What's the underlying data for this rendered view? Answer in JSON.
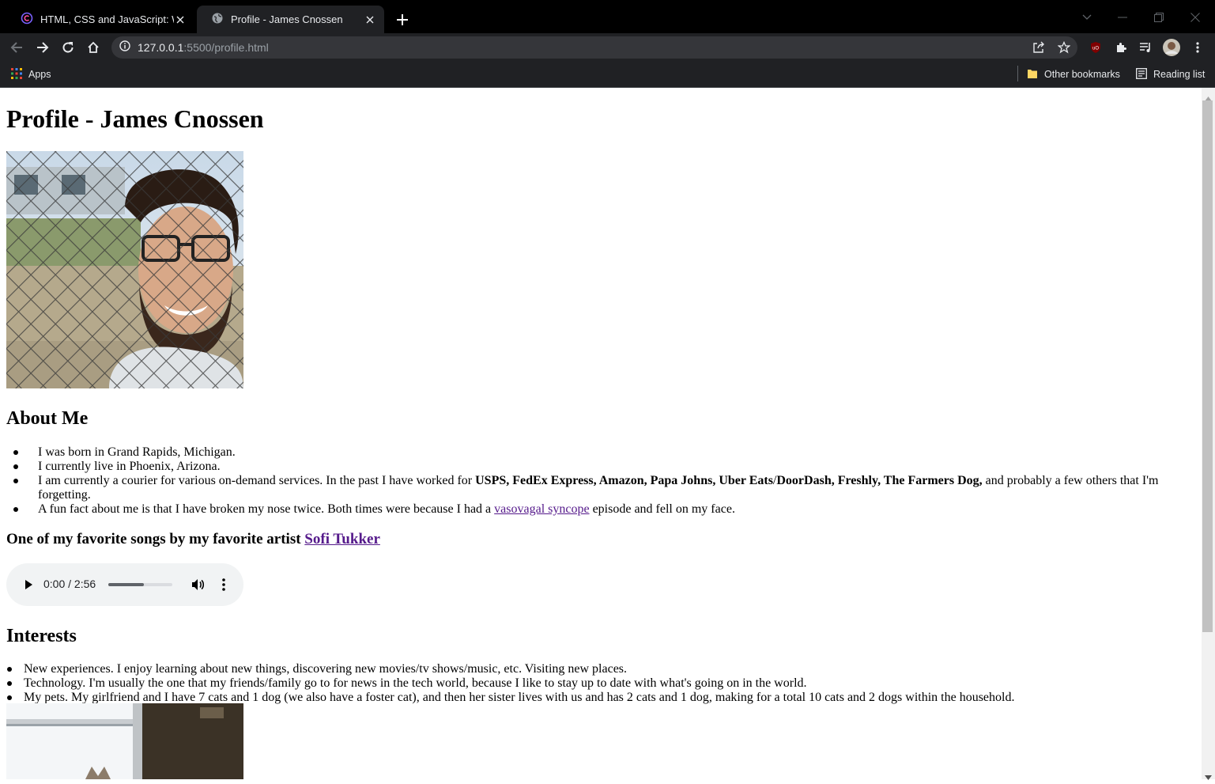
{
  "browser": {
    "tabs": [
      {
        "title": "HTML, CSS and JavaScript: Week",
        "active": false,
        "icon": "coursera-icon"
      },
      {
        "title": "Profile - James Cnossen",
        "active": true,
        "icon": "globe-icon"
      }
    ],
    "url": {
      "host": "127.0.0.1",
      "rest": ":5500/profile.html"
    },
    "bookmarks": {
      "apps_label": "Apps",
      "other_bookmarks_label": "Other bookmarks",
      "reading_list_label": "Reading list"
    },
    "extensions": [
      "ublock-icon",
      "puzzle-icon",
      "media-queue-icon",
      "profile-avatar"
    ]
  },
  "page": {
    "title": "Profile - James Cnossen",
    "about_heading": "About Me",
    "about_items": {
      "born": "I was born in Grand Rapids, Michigan.",
      "live": "I currently live in Phoenix, Arizona.",
      "work_prefix": "I am currently a courier for various on-demand services. In the past I have worked for ",
      "work_companies": "USPS, FedEx Express, Amazon, Papa Johns, Uber Eats",
      "work_sep": "/",
      "work_companies2": "DoorDash, Freshly, The Farmers Dog,",
      "work_suffix": " and probably a few others that I'm forgetting.",
      "fact_prefix": "A fun fact about me is that I have broken my nose twice. Both times were because I had a ",
      "fact_link": "vasovagal syncope",
      "fact_suffix": " episode and fell on my face."
    },
    "song_heading_prefix": "One of my favorite songs by my favorite artist ",
    "song_heading_link": "Sofi Tukker",
    "audio": {
      "time": "0:00 / 2:56",
      "progress": 0.55
    },
    "interests_heading": "Interests",
    "interests": [
      "New experiences. I enjoy learning about new things, discovering new movies/tv shows/music, etc. Visiting new places.",
      "Technology. I'm usually the one that my friends/family go to for news in the tech world, because I like to stay up to date with what's going on in the world.",
      "My pets. My girlfriend and I have 7 cats and 1 dog (we also have a foster cat), and then her sister lives with us and has 2 cats and 1 dog, making for a total 10 cats and 2 dogs within the household."
    ]
  },
  "colors": {
    "chrome_dark": "#202124",
    "tab_bar": "#000000",
    "omnibox": "#35363a",
    "visited_link": "#551a8b"
  }
}
